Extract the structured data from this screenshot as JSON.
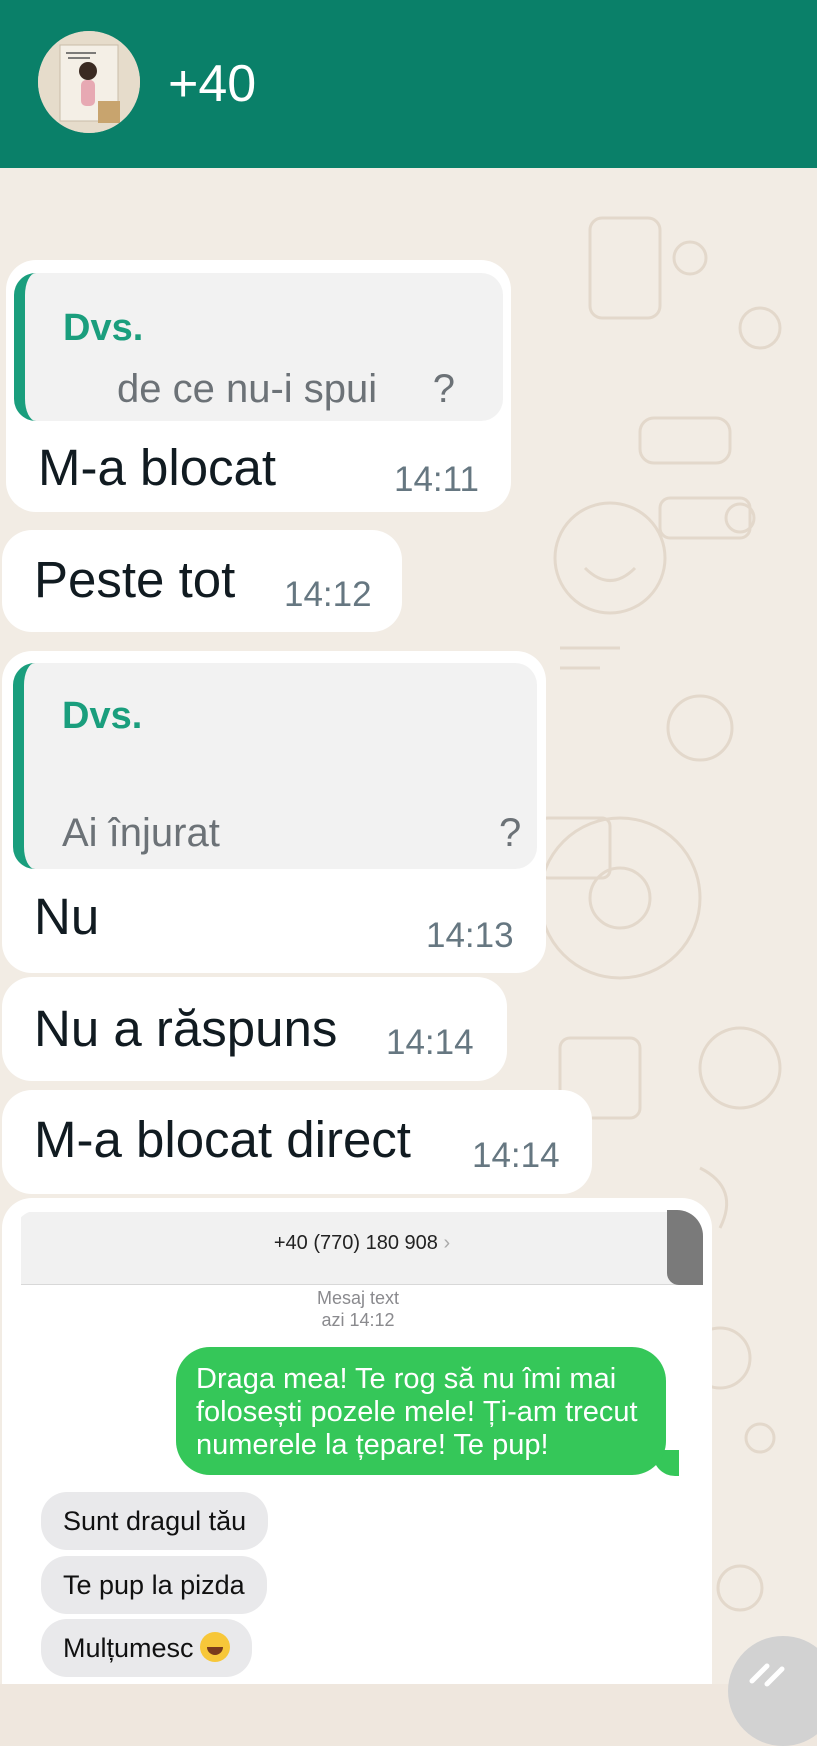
{
  "header": {
    "contact_name": "+40"
  },
  "messages": [
    {
      "quote_author": "Dvs.",
      "quote_text": "de ce nu-i spui     ?",
      "text": "M-a blocat",
      "time": "14:11"
    },
    {
      "text": "Peste tot",
      "time": "14:12"
    },
    {
      "quote_author": "Dvs.",
      "quote_text": "Ai înjurat",
      "quote_mark": "?",
      "text": "Nu",
      "time": "14:13"
    },
    {
      "text": "Nu a răspuns",
      "time": "14:14"
    },
    {
      "text": "M-a blocat direct",
      "time": "14:14"
    }
  ],
  "screenshot": {
    "phone_number": "+40 (770) 180 908",
    "chevron": "›",
    "meta_label": "Mesaj text",
    "meta_time": "azi 14:12",
    "sent_message": "Draga mea! Te rog să nu îmi mai folosești pozele mele! Ți-am trecut numerele la țepare! Te pup!",
    "replies": [
      "Sunt dragul tău",
      "Te pup la pizda",
      "Mulțumesc"
    ]
  },
  "colors": {
    "header": "#0a8069",
    "accent": "#1a9e7d",
    "sent_bubble": "#35c759"
  }
}
